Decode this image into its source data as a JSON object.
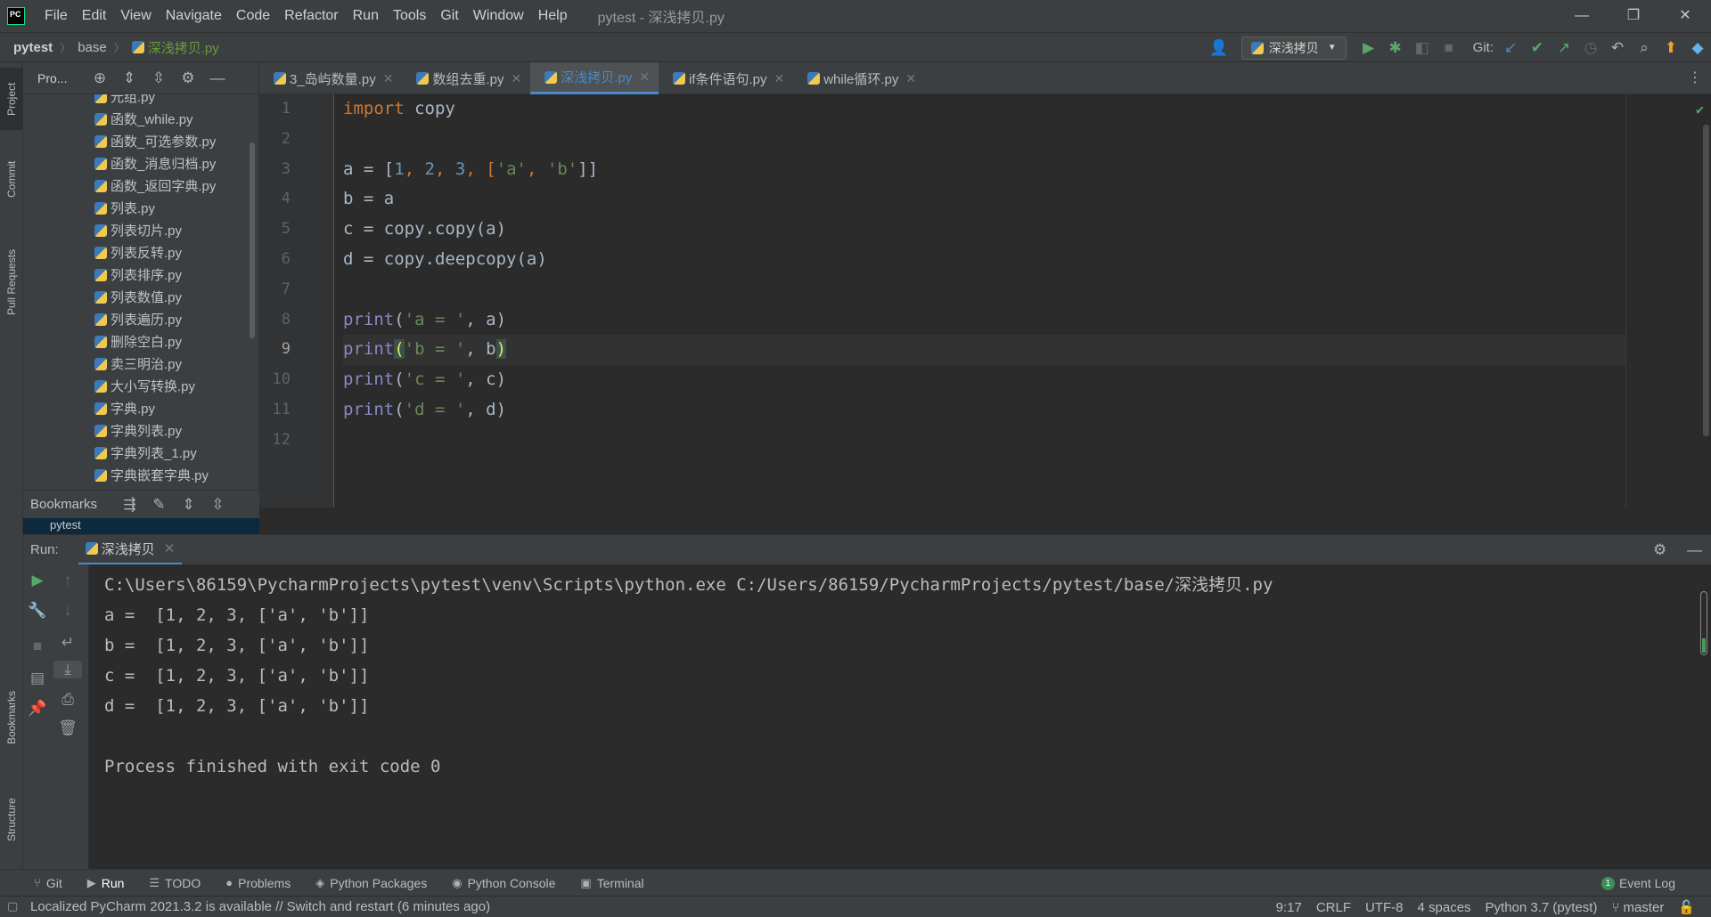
{
  "menu": [
    "File",
    "Edit",
    "View",
    "Navigate",
    "Code",
    "Refactor",
    "Run",
    "Tools",
    "Git",
    "Window",
    "Help"
  ],
  "window_title": "pytest - 深浅拷贝.py",
  "breadcrumb": {
    "project": "pytest",
    "folder": "base",
    "file": "深浅拷贝.py"
  },
  "toolbar": {
    "run_config": "深浅拷贝",
    "git_label": "Git:"
  },
  "left_tabs": {
    "project": "Project",
    "commit": "Commit",
    "pull_requests": "Pull Requests",
    "bookmarks": "Bookmarks",
    "structure": "Structure"
  },
  "project_panel": {
    "title": "Pro...",
    "files": [
      "元组.py",
      "函数_while.py",
      "函数_可选参数.py",
      "函数_消息归档.py",
      "函数_返回字典.py",
      "列表.py",
      "列表切片.py",
      "列表反转.py",
      "列表排序.py",
      "列表数值.py",
      "列表遍历.py",
      "删除空白.py",
      "卖三明治.py",
      "大小写转换.py",
      "字典.py",
      "字典列表.py",
      "字典列表_1.py",
      "字典嵌套字典.py"
    ],
    "bookmarks_title": "Bookmarks",
    "bookmarks_item": "pytest"
  },
  "tabs": [
    {
      "label": "3_岛屿数量.py",
      "active": false
    },
    {
      "label": "数组去重.py",
      "active": false
    },
    {
      "label": "深浅拷贝.py",
      "active": true
    },
    {
      "label": "if条件语句.py",
      "active": false
    },
    {
      "label": "while循环.py",
      "active": false
    }
  ],
  "editor": {
    "current_line": 9,
    "line_numbers": [
      "1",
      "2",
      "3",
      "4",
      "5",
      "6",
      "7",
      "8",
      "9",
      "10",
      "11",
      "12"
    ],
    "code": {
      "l1_kw": "import",
      "l1_rest": " copy",
      "l3_a": "a = [",
      "l3_n1": "1",
      "l3_c1": ", ",
      "l3_n2": "2",
      "l3_c2": ", ",
      "l3_n3": "3",
      "l3_c3": ", [",
      "l3_s1": "'a'",
      "l3_c4": ", ",
      "l3_s2": "'b'",
      "l3_end": "]]",
      "l4": "b = a",
      "l5": "c = copy.copy(a)",
      "l6": "d = copy.deepcopy(a)",
      "print": "print",
      "l8_open": "(",
      "l8_str": "'a = '",
      "l8_rest": ", a)",
      "l9_open": "(",
      "l9_str": "'b = '",
      "l9_mid": ", b",
      "l9_close": ")",
      "l10_open": "(",
      "l10_str": "'c = '",
      "l10_rest": ", c)",
      "l11_open": "(",
      "l11_str": "'d = '",
      "l11_rest": ", d)"
    }
  },
  "run_panel": {
    "label": "Run:",
    "tab": "深浅拷贝",
    "output": [
      "C:\\Users\\86159\\PycharmProjects\\pytest\\venv\\Scripts\\python.exe C:/Users/86159/PycharmProjects/pytest/base/深浅拷贝.py",
      "a =  [1, 2, 3, ['a', 'b']]",
      "b =  [1, 2, 3, ['a', 'b']]",
      "c =  [1, 2, 3, ['a', 'b']]",
      "d =  [1, 2, 3, ['a', 'b']]",
      "",
      "Process finished with exit code 0"
    ]
  },
  "bottom_tools": [
    "Git",
    "Run",
    "TODO",
    "Problems",
    "Python Packages",
    "Python Console",
    "Terminal"
  ],
  "event_log": {
    "count": "1",
    "label": "Event Log"
  },
  "status": {
    "message": "Localized PyCharm 2021.3.2 is available // Switch and restart (6 minutes ago)",
    "position": "9:17",
    "line_sep": "CRLF",
    "encoding": "UTF-8",
    "indent": "4 spaces",
    "interpreter": "Python 3.7 (pytest)",
    "branch": "master"
  },
  "colors": {
    "keyword": "#cc7832",
    "number": "#6897bb",
    "string": "#6a8759",
    "builtin": "#8888c6",
    "accent": "#4a88c7"
  }
}
